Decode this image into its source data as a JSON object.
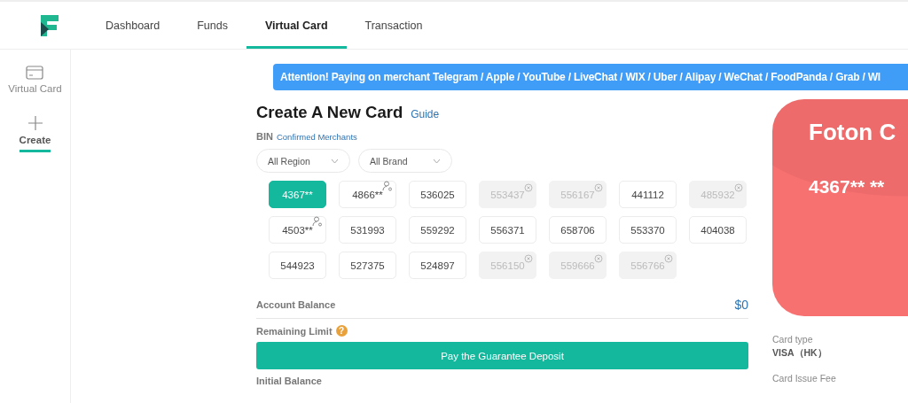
{
  "nav": {
    "tabs": [
      {
        "label": "Dashboard",
        "selected": false
      },
      {
        "label": "Funds",
        "selected": false
      },
      {
        "label": "Virtual Card",
        "selected": true
      },
      {
        "label": "Transaction",
        "selected": false
      }
    ]
  },
  "sidebar": {
    "items": [
      {
        "kind": "card",
        "label": "Virtual Card",
        "selected": false
      },
      {
        "kind": "plus",
        "label": "Create",
        "selected": true
      }
    ]
  },
  "banner": "Attention! Paying on merchant Telegram / Apple / YouTube / LiveChat / WIX / Uber / Alipay / WeChat / FoodPanda / Grab / WI",
  "form": {
    "title": "Create A New Card",
    "guide_link": "Guide",
    "bin_label": "BIN",
    "merchants_link": "Confirmed Merchants",
    "filters": [
      {
        "label": "All Region"
      },
      {
        "label": "All Brand"
      }
    ],
    "bins": [
      {
        "label": "4367**",
        "kind": "plain",
        "selected": true
      },
      {
        "label": "4866**",
        "kind": "personal",
        "selected": false
      },
      {
        "label": "536025",
        "kind": "plain",
        "selected": false
      },
      {
        "label": "553437",
        "kind": "closed",
        "selected": false
      },
      {
        "label": "556167",
        "kind": "closed",
        "selected": false
      },
      {
        "label": "441112",
        "kind": "plain",
        "selected": false
      },
      {
        "label": "485932",
        "kind": "closed",
        "selected": false
      },
      {
        "label": "4503**",
        "kind": "personal",
        "selected": false
      },
      {
        "label": "531993",
        "kind": "plain",
        "selected": false
      },
      {
        "label": "559292",
        "kind": "plain",
        "selected": false
      },
      {
        "label": "556371",
        "kind": "plain",
        "selected": false
      },
      {
        "label": "658706",
        "kind": "plain",
        "selected": false
      },
      {
        "label": "553370",
        "kind": "plain",
        "selected": false
      },
      {
        "label": "404038",
        "kind": "plain",
        "selected": false
      },
      {
        "label": "544923",
        "kind": "plain",
        "selected": false
      },
      {
        "label": "527375",
        "kind": "plain",
        "selected": false
      },
      {
        "label": "524897",
        "kind": "plain",
        "selected": false
      },
      {
        "label": "556150",
        "kind": "closed",
        "selected": false
      },
      {
        "label": "559666",
        "kind": "closed",
        "selected": false
      },
      {
        "label": "556766",
        "kind": "closed",
        "selected": false
      }
    ],
    "account_balance": {
      "label": "Account Balance",
      "value": "$0"
    },
    "remaining_limit": {
      "label": "Remaining Limit",
      "help": "?"
    },
    "deposit_button": "Pay the Guarantee Deposit",
    "initial_balance": {
      "label": "Initial Balance"
    }
  },
  "preview": {
    "card_name": "Foton C",
    "card_number": "4367** **",
    "details": [
      {
        "label": "Card type",
        "value": "VISA（HK）"
      },
      {
        "label": "Card Issue Fee"
      }
    ]
  }
}
